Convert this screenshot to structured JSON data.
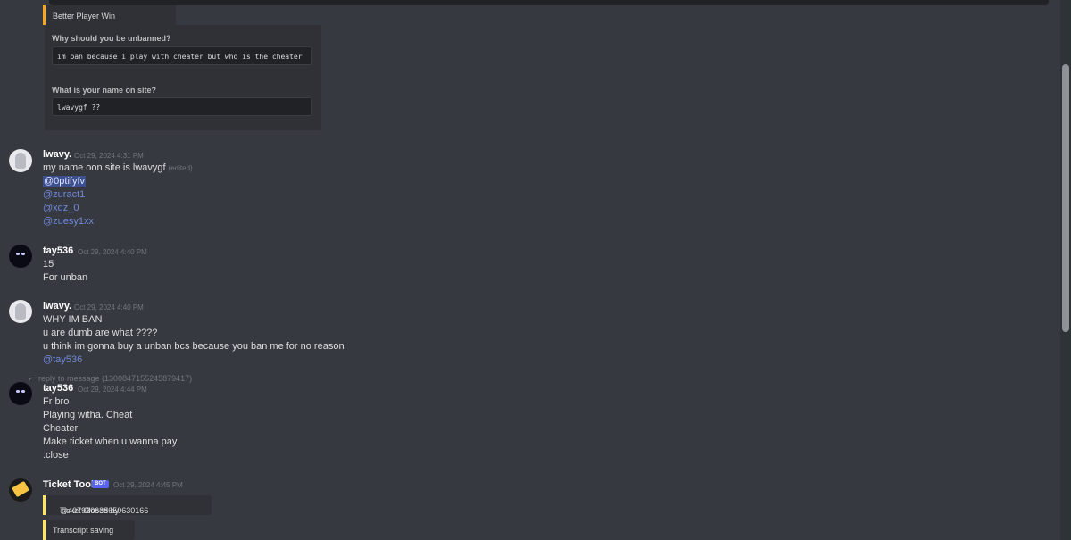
{
  "top_embed": {
    "title": "Better Player Win"
  },
  "form": {
    "q1": "Why should you be unbanned?",
    "a1": "im ban because i play with cheater but who is the cheater",
    "q2": "What is your name on site?",
    "a2": "lwavygf ??"
  },
  "messages": [
    {
      "author": "lwavy.",
      "timestamp": "Oct 29, 2024 4:31 PM",
      "line1": "my name oon site is lwavygf",
      "edited": "(edited)",
      "mentions": [
        "@0ptifyfv",
        "@zuract1",
        "@xqz_0",
        "@zuesy1xx"
      ]
    },
    {
      "author": "tay536",
      "timestamp": "Oct 29, 2024 4:40 PM",
      "lines": [
        "15",
        "For unban"
      ]
    },
    {
      "author": "lwavy.",
      "timestamp": "Oct 29, 2024 4:40 PM",
      "lines": [
        "WHY IM BAN",
        "u are dumb are what ????",
        "u think im gonna buy a unban bcs because you ban me for no reason"
      ],
      "mention": "@tay536"
    },
    {
      "reply": "reply to message (1300847155245879417)",
      "author": "tay536",
      "timestamp": "Oct 29, 2024 4:44 PM",
      "lines": [
        "Fr bro",
        "Playing witha. Cheat",
        "Cheater",
        "Make ticket when u wanna pay",
        ".close"
      ]
    },
    {
      "author": "Ticket Tool",
      "badge": "BOT",
      "timestamp": "Oct 29, 2024 4:45 PM",
      "embed1_text": "Ticket Closed by",
      "embed1_mention": "@407980638650630166",
      "embed2_text": "Transcript saving"
    }
  ],
  "colors": {
    "background": "#36393f",
    "embed_bg": "#2f3136",
    "mention": "#7289da",
    "embed_accent": "#fee75c",
    "top_accent": "#faa61a"
  },
  "icons": [
    "ticket-icon"
  ]
}
